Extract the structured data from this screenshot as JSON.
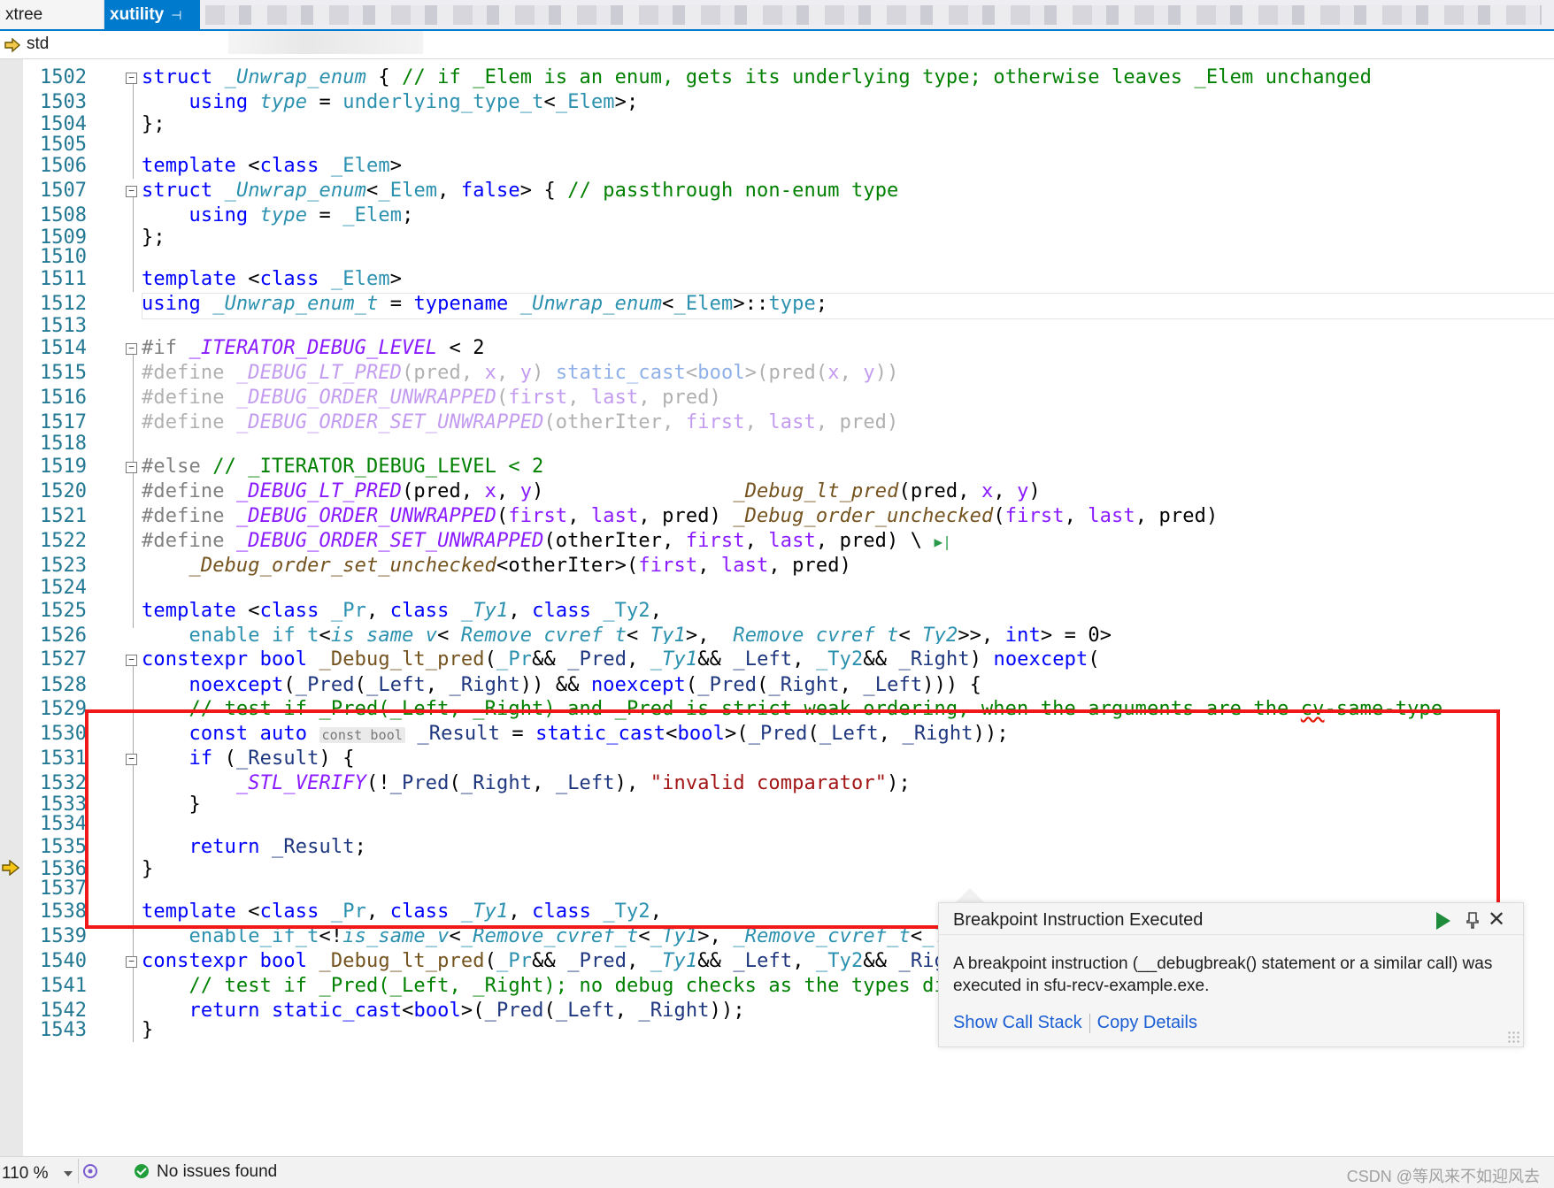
{
  "tabs": [
    {
      "label": "xtree",
      "active": false
    },
    {
      "label": "xutility",
      "active": true,
      "pin_icon": "pin-icon"
    }
  ],
  "navbar": {
    "scope": "std",
    "icon": "namespace-icon"
  },
  "editor": {
    "current_line": "1532",
    "lines": [
      {
        "n": "1502"
      },
      {
        "n": "1503"
      },
      {
        "n": "1504"
      },
      {
        "n": "1505"
      },
      {
        "n": "1506"
      },
      {
        "n": "1507"
      },
      {
        "n": "1508"
      },
      {
        "n": "1509"
      },
      {
        "n": "1510"
      },
      {
        "n": "1511"
      },
      {
        "n": "1512"
      },
      {
        "n": "1513"
      },
      {
        "n": "1514"
      },
      {
        "n": "1515"
      },
      {
        "n": "1516"
      },
      {
        "n": "1517"
      },
      {
        "n": "1518"
      },
      {
        "n": "1519"
      },
      {
        "n": "1520"
      },
      {
        "n": "1521"
      },
      {
        "n": "1522"
      },
      {
        "n": "1523"
      },
      {
        "n": "1524"
      },
      {
        "n": "1525"
      },
      {
        "n": "1526"
      },
      {
        "n": "1527"
      },
      {
        "n": "1528"
      },
      {
        "n": "1529"
      },
      {
        "n": "1530"
      },
      {
        "n": "1531"
      },
      {
        "n": "1532"
      },
      {
        "n": "1533"
      },
      {
        "n": "1534"
      },
      {
        "n": "1535"
      },
      {
        "n": "1536"
      },
      {
        "n": "1537"
      },
      {
        "n": "1538"
      },
      {
        "n": "1539"
      },
      {
        "n": "1540"
      },
      {
        "n": "1541"
      },
      {
        "n": "1542"
      },
      {
        "n": "1543"
      }
    ],
    "inline_hint": "const bool"
  },
  "exception_popup": {
    "title": "Breakpoint Instruction Executed",
    "message": "A breakpoint instruction (__debugbreak() statement or a similar call) was executed in sfu-recv-example.exe.",
    "links": [
      "Show Call Stack",
      "Copy Details"
    ]
  },
  "statusbar": {
    "zoom": "110 %",
    "issues": "No issues found"
  },
  "watermark": "CSDN @等风来不如迎风去",
  "colors": {
    "accent": "#007acc",
    "highlight_box": "#f01818",
    "keyword": "#0000ff",
    "comment": "#008000",
    "string": "#a31515"
  }
}
